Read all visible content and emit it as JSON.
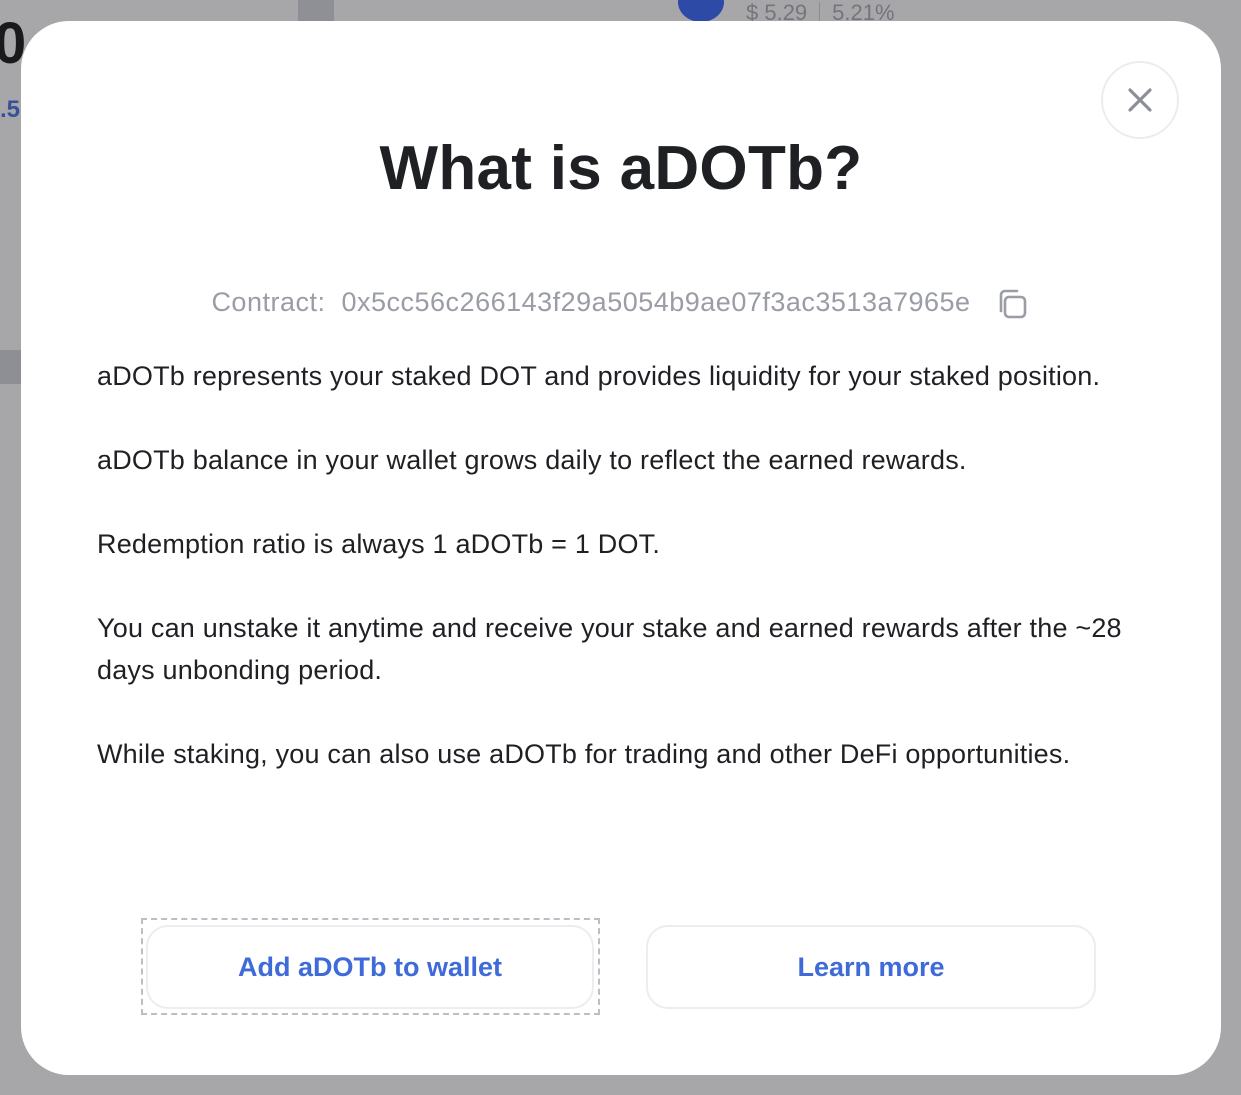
{
  "background": {
    "big_text": "0",
    "link_text": ".5",
    "price": "$ 5.29",
    "apy": "5.21%"
  },
  "modal": {
    "title": "What is aDOTb?",
    "close_icon": "close-icon",
    "contract": {
      "label": "Contract:",
      "address": "0x5cc56c266143f29a5054b9ae07f3ac3513a7965e",
      "copy_icon": "copy-icon"
    },
    "paragraphs": [
      "aDOTb represents your staked DOT and provides liquidity for your staked position.",
      "aDOTb balance in your wallet grows daily to reflect the earned rewards.",
      "Redemption ratio is always 1 aDOTb = 1 DOT.",
      "You can unstake it anytime and receive your stake and earned rewards after the ~28 days unbonding period.",
      "While staking, you can also use aDOTb for trading and other DeFi opportunities."
    ],
    "buttons": {
      "add_to_wallet": "Add aDOTb to wallet",
      "learn_more": "Learn more"
    },
    "colors": {
      "accent": "#3f6bd8",
      "title": "#1f2024",
      "muted": "#9a9ca6"
    }
  }
}
